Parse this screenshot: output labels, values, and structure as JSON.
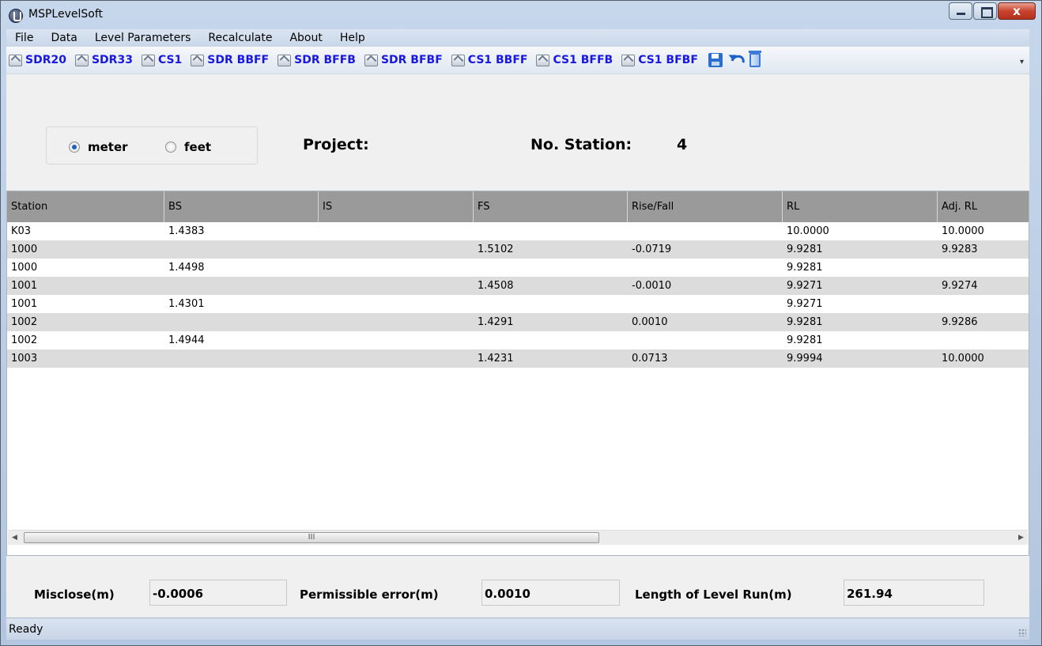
{
  "window": {
    "title": "MSPLevelSoft",
    "close_glyph": "x"
  },
  "menu": [
    "File",
    "Data",
    "Level Parameters",
    "Recalculate",
    "About",
    "Help"
  ],
  "toolbar": {
    "buttons": [
      "SDR20",
      "SDR33",
      "CS1",
      "SDR BBFF",
      "SDR BFFB",
      "SDR BFBF",
      "CS1 BBFF",
      "CS1 BFFB",
      "CS1 BFBF"
    ],
    "icons": [
      "save-icon",
      "undo-icon",
      "delete-icon"
    ]
  },
  "units": {
    "options": [
      "meter",
      "feet"
    ],
    "selected": "meter"
  },
  "project": {
    "label": "Project:",
    "value": ""
  },
  "stations": {
    "label": "No. Station:",
    "value": "4"
  },
  "table": {
    "columns": [
      "Station",
      "BS",
      "IS",
      "FS",
      "Rise/Fall",
      "RL",
      "Adj. RL"
    ],
    "rows": [
      [
        "K03",
        "1.4383",
        "",
        "",
        "",
        "10.0000",
        "10.0000"
      ],
      [
        "1000",
        "",
        "",
        "1.5102",
        "-0.0719",
        "9.9281",
        "9.9283"
      ],
      [
        "1000",
        "1.4498",
        "",
        "",
        "",
        "9.9281",
        ""
      ],
      [
        "1001",
        "",
        "",
        "1.4508",
        "-0.0010",
        "9.9271",
        "9.9274"
      ],
      [
        "1001",
        "1.4301",
        "",
        "",
        "",
        "9.9271",
        ""
      ],
      [
        "1002",
        "",
        "",
        "1.4291",
        "0.0010",
        "9.9281",
        "9.9286"
      ],
      [
        "1002",
        "1.4944",
        "",
        "",
        "",
        "9.9281",
        ""
      ],
      [
        "1003",
        "",
        "",
        "1.4231",
        "0.0713",
        "9.9994",
        "10.0000"
      ]
    ],
    "scroll_thumb_grip": "III"
  },
  "summary": {
    "misclose_label": "Misclose(m)",
    "misclose_value": "-0.0006",
    "permissible_label": "Permissible error(m)",
    "permissible_value": "0.0010",
    "length_label": "Length of Level Run(m)",
    "length_value": "261.94"
  },
  "status": "Ready"
}
